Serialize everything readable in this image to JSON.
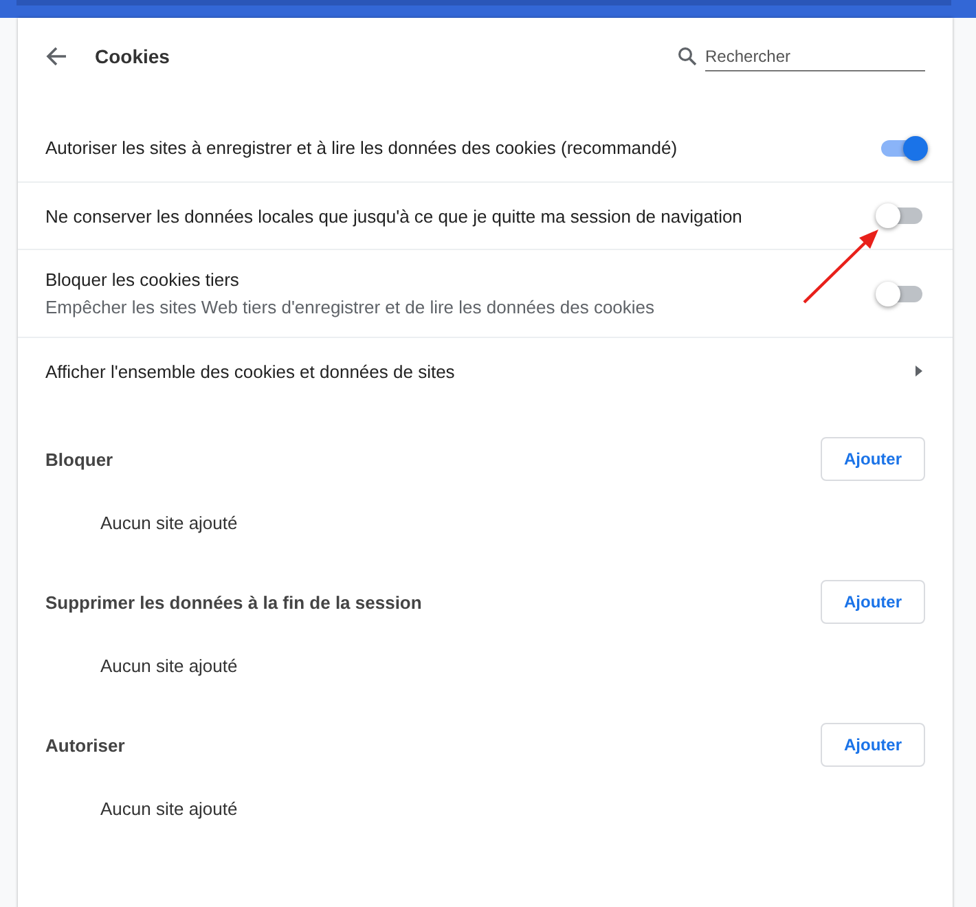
{
  "header": {
    "title": "Cookies",
    "search": {
      "placeholder": "Rechercher"
    }
  },
  "settings": [
    {
      "kind": "toggle",
      "label": "Autoriser les sites à enregistrer et à lire les données des cookies (recommandé)",
      "on": true
    },
    {
      "kind": "toggle",
      "label": "Ne conserver les données locales que jusqu'à ce que je quitte ma session de navigation",
      "on": false
    },
    {
      "kind": "toggle",
      "label": "Bloquer les cookies tiers",
      "sublabel": "Empêcher les sites Web tiers d'enregistrer et de lire les données des cookies",
      "on": false
    },
    {
      "kind": "link",
      "label": "Afficher l'ensemble des cookies et données de sites"
    }
  ],
  "sections": [
    {
      "title": "Bloquer",
      "button": "Ajouter",
      "empty": "Aucun site ajouté"
    },
    {
      "title": "Supprimer les données à la fin de la session",
      "button": "Ajouter",
      "empty": "Aucun site ajouté"
    },
    {
      "title": "Autoriser",
      "button": "Ajouter",
      "empty": "Aucun site ajouté"
    }
  ]
}
